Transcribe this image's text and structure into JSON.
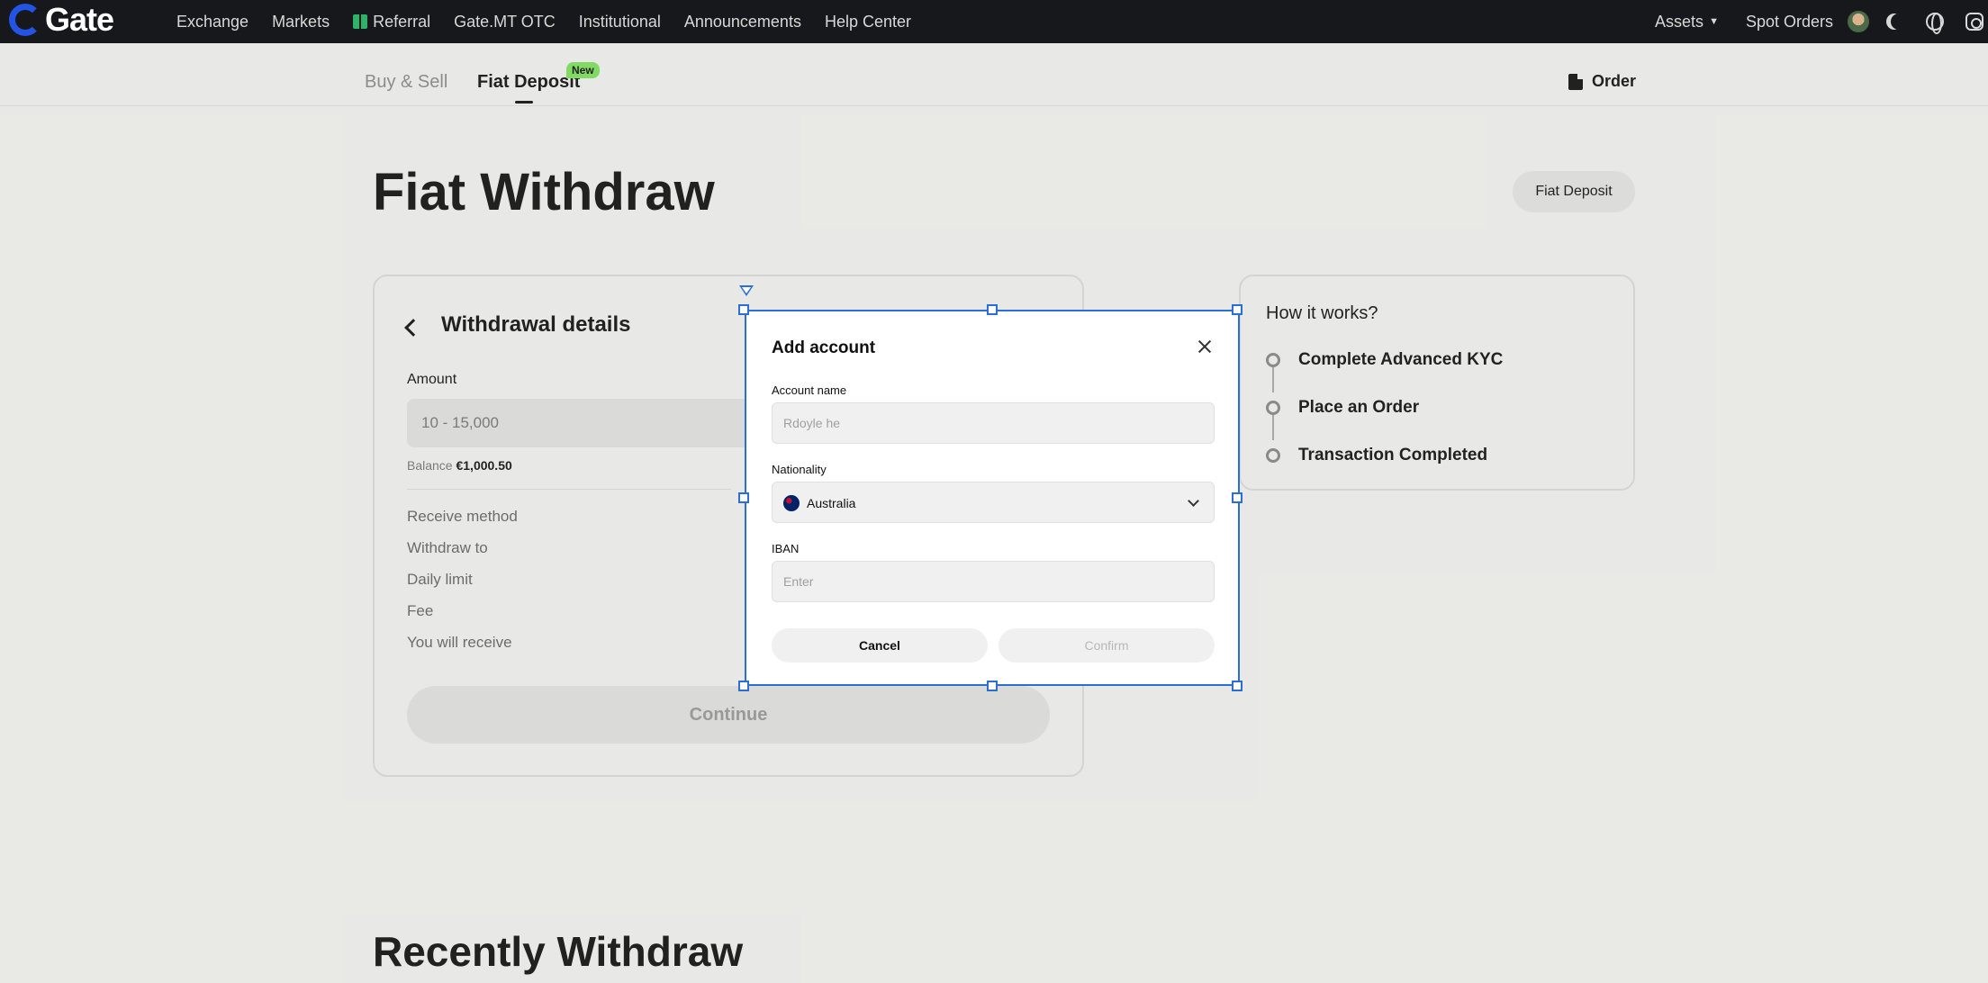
{
  "brand": {
    "logo_text": "Gate"
  },
  "topnav": {
    "links": [
      "Exchange",
      "Markets",
      "Referral",
      "Gate.MT OTC",
      "Institutional",
      "Announcements",
      "Help Center"
    ],
    "assets_label": "Assets",
    "spot_orders_label": "Spot Orders"
  },
  "subnav": {
    "tabs": [
      {
        "label": "Buy & Sell",
        "active": false
      },
      {
        "label": "Fiat Deposit",
        "active": true,
        "badge": "New"
      }
    ],
    "order_label": "Order"
  },
  "page": {
    "title": "Fiat Withdraw",
    "fiat_deposit_button": "Fiat Deposit",
    "recent_title": "Recently Withdraw"
  },
  "withdrawal": {
    "title": "Withdrawal details",
    "amount_label": "Amount",
    "amount_placeholder": "10 - 15,000",
    "balance_label": "Balance",
    "balance_value": "€1,000.50",
    "rows": [
      "Receive method",
      "Withdraw to",
      "Daily limit",
      "Fee",
      "You will receive"
    ],
    "continue_label": "Continue"
  },
  "how_it_works": {
    "title": "How it works?",
    "steps": [
      "Complete Advanced KYC",
      "Place an Order",
      "Transaction Completed"
    ]
  },
  "modal": {
    "title": "Add account",
    "account_name_label": "Account name",
    "account_name_placeholder": "Rdoyle he",
    "nationality_label": "Nationality",
    "nationality_value": "Australia",
    "iban_label": "IBAN",
    "iban_placeholder": "Enter",
    "cancel_label": "Cancel",
    "confirm_label": "Confirm"
  },
  "colors": {
    "nav_bg": "#17181b",
    "brand_blue": "#2354e6",
    "badge_green": "#7ee35d",
    "selection_blue": "#2b6fd6"
  }
}
